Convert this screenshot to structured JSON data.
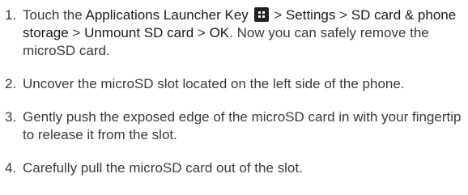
{
  "steps": [
    {
      "number": "1.",
      "parts": {
        "touch": "Touch the ",
        "app_key": "Applications Launcher Key",
        "sep1": " > ",
        "settings": "Settings",
        "sep2": " > ",
        "sd_storage": "SD card & phone storage",
        "sep3": " > ",
        "unmount": "Unmount SD card",
        "sep4": " > ",
        "ok": "OK",
        "rest": ". Now you can safely remove the microSD card."
      },
      "icon": "applications-launcher-key-icon"
    },
    {
      "number": "2.",
      "text": "Uncover the microSD slot located on the left side of the phone."
    },
    {
      "number": "3.",
      "text": "Gently push the exposed edge of the microSD card in with your fingertip to release it from the slot."
    },
    {
      "number": "4.",
      "text": "Carefully pull the microSD card out of the slot."
    }
  ]
}
